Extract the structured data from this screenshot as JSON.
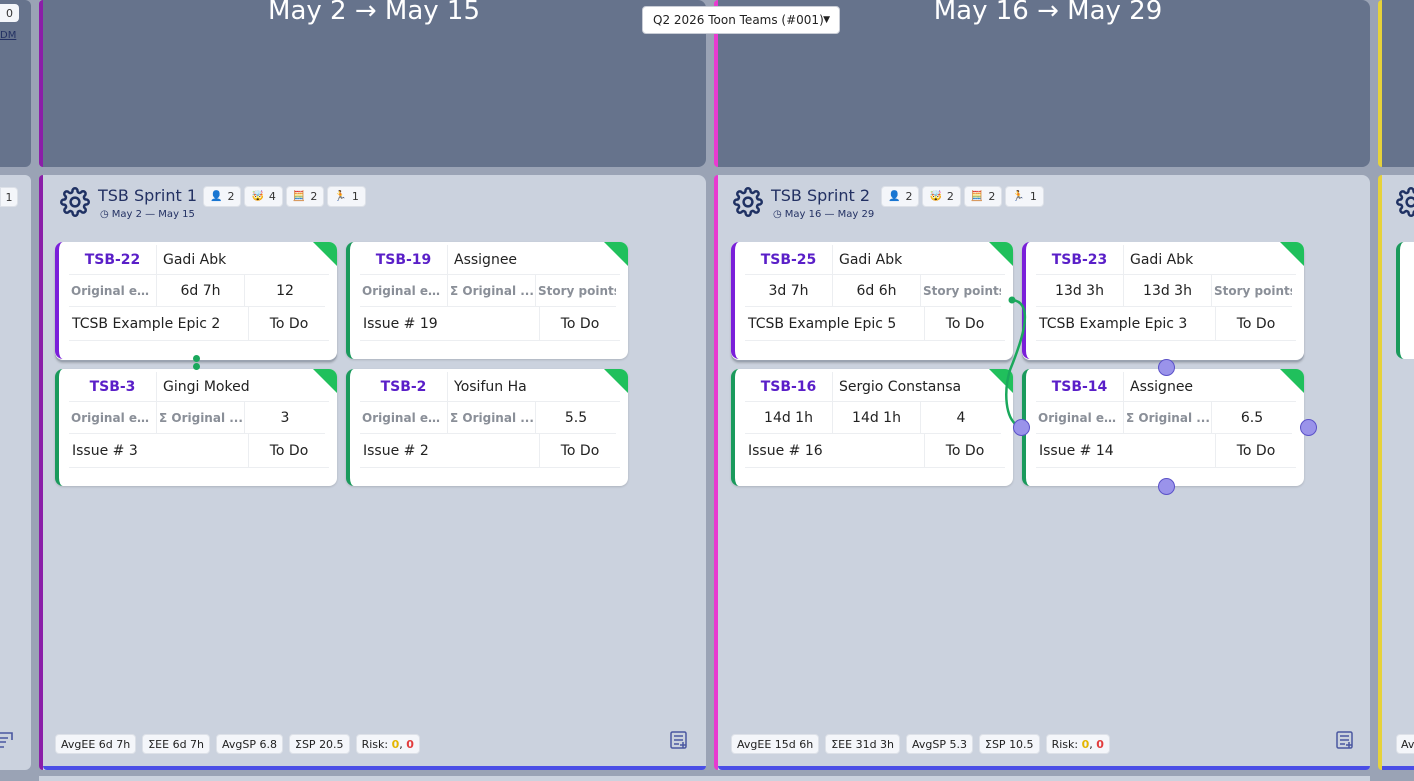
{
  "board_select": {
    "value": "Q2 2026 Toon Teams (#001)"
  },
  "left_edge": {
    "badge_top": "0",
    "link_text": "DM",
    "badge_count": "1",
    "footer_text": ""
  },
  "right_edge": {
    "footer_text": "Av"
  },
  "periods": [
    {
      "title": "May 2 → May 15"
    },
    {
      "title": "May 16 → May 29"
    }
  ],
  "sprints": [
    {
      "name": "TSB Sprint 1",
      "dates": "May 2 — May 15",
      "badges": [
        {
          "icon": "person-icon",
          "glyph": "👤",
          "count": "2"
        },
        {
          "icon": "face-icon",
          "glyph": "🤯",
          "count": "4"
        },
        {
          "icon": "abacus-icon",
          "glyph": "🧮",
          "count": "2"
        },
        {
          "icon": "runner-icon",
          "glyph": "🏃",
          "count": "1"
        }
      ],
      "cards": [
        {
          "key": "TSB-22",
          "assignee": "Gadi Abk",
          "c1": "Original esti...",
          "c1_label": true,
          "c2": "6d 7h",
          "c2_label": false,
          "c3": "12",
          "c3_label": false,
          "epic": "TCSB Example Epic 2",
          "status": "To Do",
          "type": "epic"
        },
        {
          "key": "TSB-19",
          "assignee": "Assignee",
          "c1": "Original esti...",
          "c1_label": true,
          "c2": "Σ Original ...",
          "c2_label": true,
          "c3": "Story points",
          "c3_label": true,
          "epic": "Issue # 19",
          "status": "To Do",
          "type": "story"
        },
        {
          "key": "TSB-3",
          "assignee": "Gingi Moked",
          "c1": "Original esti...",
          "c1_label": true,
          "c2": "Σ Original ...",
          "c2_label": true,
          "c3": "3",
          "c3_label": false,
          "epic": "Issue # 3",
          "status": "To Do",
          "type": "story"
        },
        {
          "key": "TSB-2",
          "assignee": "Yosifun Ha",
          "c1": "Original esti...",
          "c1_label": true,
          "c2": "Σ Original ...",
          "c2_label": true,
          "c3": "5.5",
          "c3_label": false,
          "epic": "Issue # 2",
          "status": "To Do",
          "type": "story"
        }
      ],
      "footer": {
        "avg_ee": "AvgEE 6d 7h",
        "sum_ee": "ΣEE 6d 7h",
        "avg_sp": "AvgSP 6.8",
        "sum_sp": "ΣSP 20.5",
        "risk_label": "Risk:",
        "risk_a": "0",
        "risk_sep": ",",
        "risk_b": "0"
      }
    },
    {
      "name": "TSB Sprint 2",
      "dates": "May 16 — May 29",
      "badges": [
        {
          "icon": "person-icon",
          "glyph": "👤",
          "count": "2"
        },
        {
          "icon": "face-icon",
          "glyph": "🤯",
          "count": "2"
        },
        {
          "icon": "abacus-icon",
          "glyph": "🧮",
          "count": "2"
        },
        {
          "icon": "runner-icon",
          "glyph": "🏃",
          "count": "1"
        }
      ],
      "cards": [
        {
          "key": "TSB-25",
          "assignee": "Gadi Abk",
          "c1": "3d 7h",
          "c1_label": false,
          "c2": "6d 6h",
          "c2_label": false,
          "c3": "Story points",
          "c3_label": true,
          "epic": "TCSB Example Epic 5",
          "status": "To Do",
          "type": "epic"
        },
        {
          "key": "TSB-23",
          "assignee": "Gadi Abk",
          "c1": "13d 3h",
          "c1_label": false,
          "c2": "13d 3h",
          "c2_label": false,
          "c3": "Story points",
          "c3_label": true,
          "epic": "TCSB Example Epic 3",
          "status": "To Do",
          "type": "epic"
        },
        {
          "key": "TSB-16",
          "assignee": "Sergio Constansa",
          "c1": "14d 1h",
          "c1_label": false,
          "c2": "14d 1h",
          "c2_label": false,
          "c3": "4",
          "c3_label": false,
          "epic": "Issue # 16",
          "status": "To Do",
          "type": "story"
        },
        {
          "key": "TSB-14",
          "assignee": "Assignee",
          "c1": "Original esti...",
          "c1_label": true,
          "c2": "Σ Original ...",
          "c2_label": true,
          "c3": "6.5",
          "c3_label": false,
          "epic": "Issue # 14",
          "status": "To Do",
          "type": "story"
        }
      ],
      "footer": {
        "avg_ee": "AvgEE 15d 6h",
        "sum_ee": "ΣEE 31d 3h",
        "avg_sp": "AvgSP 5.3",
        "sum_sp": "ΣSP 10.5",
        "risk_label": "Risk:",
        "risk_a": "0",
        "risk_sep": ",",
        "risk_b": "0"
      }
    }
  ],
  "colors": {
    "header_bg": "#66738c",
    "sprint_bg": "#cbd2de",
    "sprint1_accent": "#8b1ea8",
    "sprint2_accent": "#e83ad0",
    "sprint3_accent": "#e6d23a",
    "sprint_bottom": "#4a4ee6",
    "epic_border": "#7a1fd9",
    "story_border": "#1a9a5c",
    "key_text": "#5a1fc8"
  }
}
